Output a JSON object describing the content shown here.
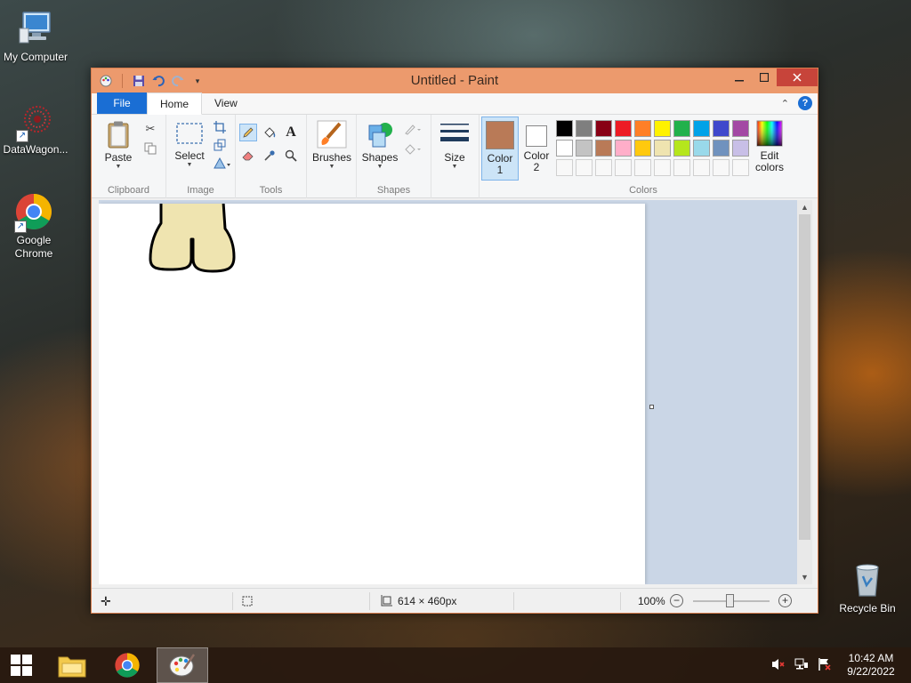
{
  "desktop": {
    "icons": [
      {
        "label": "My Computer"
      },
      {
        "label": "DataWagon..."
      },
      {
        "label": "Google Chrome"
      },
      {
        "label": "Recycle Bin"
      }
    ]
  },
  "window": {
    "title": "Untitled - Paint",
    "tabs": [
      {
        "label": "File"
      },
      {
        "label": "Home"
      },
      {
        "label": "View"
      }
    ],
    "groups": {
      "clipboard": "Clipboard",
      "image": "Image",
      "tools": "Tools",
      "shapes": "Shapes",
      "colors": "Colors"
    },
    "buttons": {
      "paste": "Paste",
      "select": "Select",
      "brushes": "Brushes",
      "shapes": "Shapes",
      "size": "Size",
      "color1_line1": "Color",
      "color1_line2": "1",
      "color2_line1": "Color",
      "color2_line2": "2",
      "edit_colors_line1": "Edit",
      "edit_colors_line2": "colors"
    },
    "color1": "#b97a57",
    "color2": "#ffffff",
    "palette": [
      "#000000",
      "#7f7f7f",
      "#880015",
      "#ed1c24",
      "#ff7f27",
      "#fff200",
      "#22b14c",
      "#00a2e8",
      "#3f48cc",
      "#a349a4",
      "#ffffff",
      "#c3c3c3",
      "#b97a57",
      "#ffaec9",
      "#ffc90e",
      "#efe4b0",
      "#b5e61d",
      "#99d9ea",
      "#7092be",
      "#c8bfe7"
    ],
    "status": {
      "dimensions": "614 × 460px",
      "zoom": "100%"
    }
  },
  "taskbar": {
    "time": "10:42 AM",
    "date": "9/22/2022"
  }
}
